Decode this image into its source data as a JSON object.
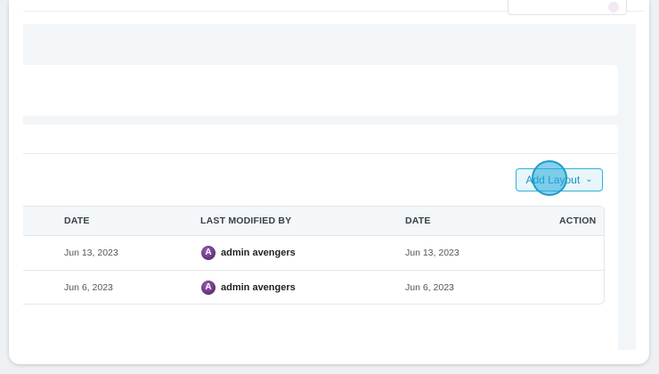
{
  "toolbar": {
    "add_layout_label": "Add Layout",
    "dropdown_glyph": "⌄"
  },
  "table": {
    "columns": [
      "DATE",
      "LAST MODIFIED BY",
      "DATE",
      "ACTION"
    ],
    "rows": [
      {
        "date": "Jun 13, 2023",
        "modified_by": "admin avengers",
        "modified_date": "Jun 13, 2023"
      },
      {
        "date": "Jun 6, 2023",
        "modified_by": "admin avengers",
        "modified_date": "Jun 6, 2023"
      }
    ]
  },
  "icons": {
    "avatar": "avengers-logo-icon",
    "dropdown": "chevron-down-icon"
  },
  "colors": {
    "accent": "#1793bb",
    "accent_bg": "#e8f6fb",
    "avatar": "#6b2f85"
  }
}
